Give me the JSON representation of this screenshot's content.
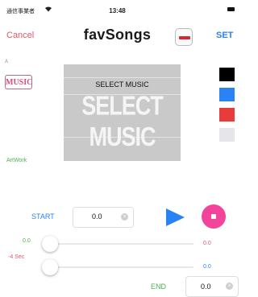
{
  "status_bar": {
    "carrier": "通信事業者",
    "time": "13:48",
    "icons": [
      "wifi-icon",
      "battery-icon"
    ]
  },
  "header": {
    "cancel_label": "Cancel",
    "title": "favSongs",
    "delete_icon": "minus-icon",
    "set_label": "SET"
  },
  "left_panel": {
    "small_label": "A",
    "music_badge": "MUSIC",
    "artwork_label": "ArtWork"
  },
  "picker": {
    "label": "SELECT MUSIC",
    "big_label": "SELECT MUSIC"
  },
  "colors": {
    "swatches": [
      "#000000",
      "#2a83f4",
      "#e83b3b",
      "#e6e6ea"
    ],
    "accent_red": "#e0566b",
    "accent_blue": "#2a83f4",
    "accent_green": "#4caf50",
    "record_pink": "#f2449a"
  },
  "start": {
    "label": "START",
    "value": "0.0",
    "clear_icon": "clear-icon"
  },
  "controls": {
    "play_icon": "play-icon",
    "record_icon": "record-icon"
  },
  "slider1": {
    "left_value": "0.0",
    "right_value": "0.0",
    "position": 0
  },
  "slider2": {
    "left_label": "-4 Sec",
    "right_value": "0.0",
    "position": 0
  },
  "end": {
    "label": "END",
    "value": "0.0",
    "clear_icon": "clear-icon"
  }
}
